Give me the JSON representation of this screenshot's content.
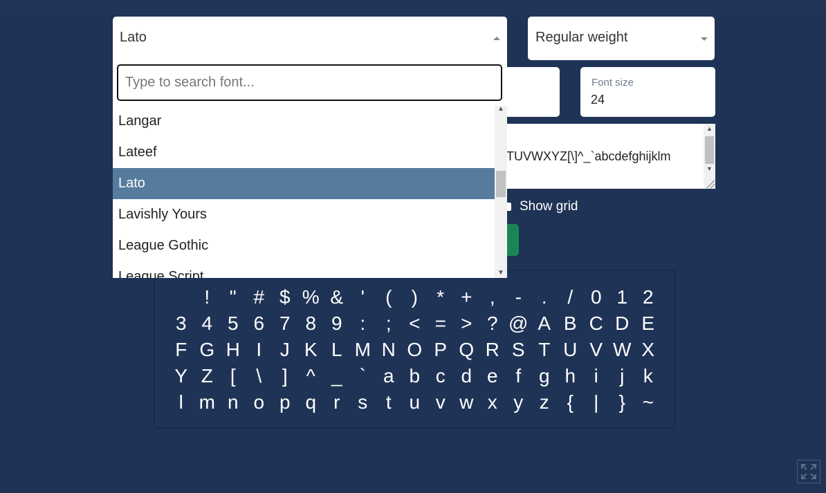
{
  "font_select": {
    "value": "Lato"
  },
  "weight_select": {
    "value": "Regular weight"
  },
  "font_search": {
    "placeholder": "Type to search font..."
  },
  "font_options": [
    {
      "label": "Langar",
      "selected": false
    },
    {
      "label": "Lateef",
      "selected": false
    },
    {
      "label": "Lato",
      "selected": true
    },
    {
      "label": "Lavishly Yours",
      "selected": false
    },
    {
      "label": "League Gothic",
      "selected": false
    },
    {
      "label": "League Script",
      "selected": false
    }
  ],
  "font_size": {
    "label": "Font size",
    "value": "24"
  },
  "sample_text": {
    "value": "TUVWXYZ[\\]^_`abcdefghijklm"
  },
  "show_grid": {
    "label": "Show grid"
  },
  "glyphs": [
    " ",
    "!",
    "\"",
    "#",
    "$",
    "%",
    "&",
    "'",
    "(",
    ")",
    "*",
    "+",
    ",",
    "-",
    ".",
    "/",
    "0",
    "1",
    "2",
    "3",
    "4",
    "5",
    "6",
    "7",
    "8",
    "9",
    ":",
    ";",
    "<",
    "=",
    ">",
    "?",
    "@",
    "A",
    "B",
    "C",
    "D",
    "E",
    "F",
    "G",
    "H",
    "I",
    "J",
    "K",
    "L",
    "M",
    "N",
    "O",
    "P",
    "Q",
    "R",
    "S",
    "T",
    "U",
    "V",
    "W",
    "X",
    "Y",
    "Z",
    "[",
    "\\",
    "]",
    "^",
    "_",
    "`",
    "a",
    "b",
    "c",
    "d",
    "e",
    "f",
    "g",
    "h",
    "i",
    "j",
    "k",
    "l",
    "m",
    "n",
    "o",
    "p",
    "q",
    "r",
    "s",
    "t",
    "u",
    "v",
    "w",
    "x",
    "y",
    "z",
    "{",
    "|",
    "}",
    "~"
  ],
  "colors": {
    "background": "#1f3356",
    "selected_option": "#557b9d",
    "action_button": "#198754"
  },
  "icons": {
    "fullscreen": "expand-arrows-icon",
    "select_caret": "caret-icon"
  }
}
